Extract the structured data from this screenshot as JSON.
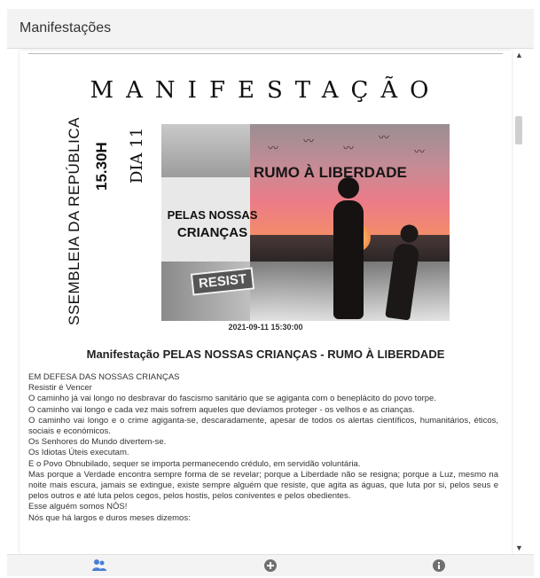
{
  "header": {
    "title": "Manifestações"
  },
  "poster": {
    "title": "MANIFESTAÇÃO",
    "location": "SSEMBLEIA DA REPÚBLICA",
    "time": "15.30H",
    "day": "DIA 11",
    "slogan_top": "RUMO À LIBERDADE",
    "slogan_line1": "PELAS NOSSAS",
    "slogan_line2": "CRIANÇAS",
    "resist_sign": "RESIST",
    "date": "2021-09-11 15:30:00"
  },
  "post": {
    "title": "Manifestação PELAS NOSSAS CRIANÇAS - RUMO À LIBERDADE",
    "paragraphs": [
      "EM DEFESA DAS NOSSAS CRIANÇAS",
      "Resistir é Vencer",
      "O caminho já vai longo no desbravar do fascismo sanitário que se agiganta com o beneplácito do povo torpe.",
      "O caminho vai longo e cada vez mais sofrem aqueles que devíamos proteger - os velhos e as crianças.",
      "O caminho vai longo e o crime agiganta-se, descaradamente, apesar de todos os alertas científicos, humanitários, éticos, sociais e económicos.",
      "Os Senhores do Mundo divertem-se.",
      "Os Idiotas Úteis executam.",
      "E o Povo Obnubilado, sequer se importa permanecendo crédulo, em servidão voluntária.",
      "Mas porque a Verdade encontra sempre forma de se revelar; porque a Liberdade não se resigna; porque a Luz, mesmo na noite mais escura, jamais se extingue, existe sempre alguém que resiste, que agita as águas, que luta por si, pelos seus e pelos outros e até luta pelos cegos, pelos hostis, pelos coniventes e pelos obedientes.",
      "Esse alguém somos NÓS!",
      "Nós que há largos e duros meses dizemos:"
    ]
  },
  "nav": {
    "icons": [
      "people-icon",
      "add-circle-icon",
      "info-icon"
    ],
    "active_color": "#4a7fd4",
    "inactive_color": "#6f6f6f"
  }
}
